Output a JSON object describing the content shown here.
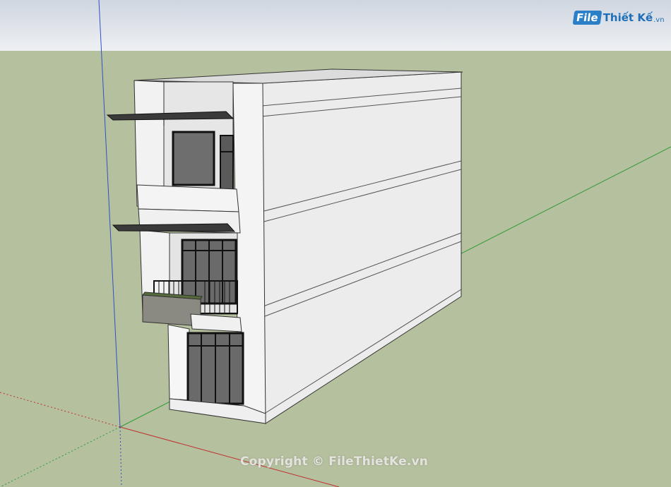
{
  "scene": {
    "view": "3d-model-viewport",
    "subject": "three-storey-townhouse",
    "colors": {
      "sky": "#dde2ea",
      "ground": "#b5c09e",
      "wall_light": "#f2f2f2",
      "wall_side": "#e4e4e4",
      "glass": "#6b6b6b",
      "frame": "#222222",
      "axis_red": "#c03030",
      "axis_green": "#2f9a3a",
      "axis_blue": "#3050c8"
    }
  },
  "logo": {
    "badge": "File",
    "text": "Thiết Kế",
    "suffix": ".vn"
  },
  "watermark": "Copyright © FileThietKe.vn"
}
